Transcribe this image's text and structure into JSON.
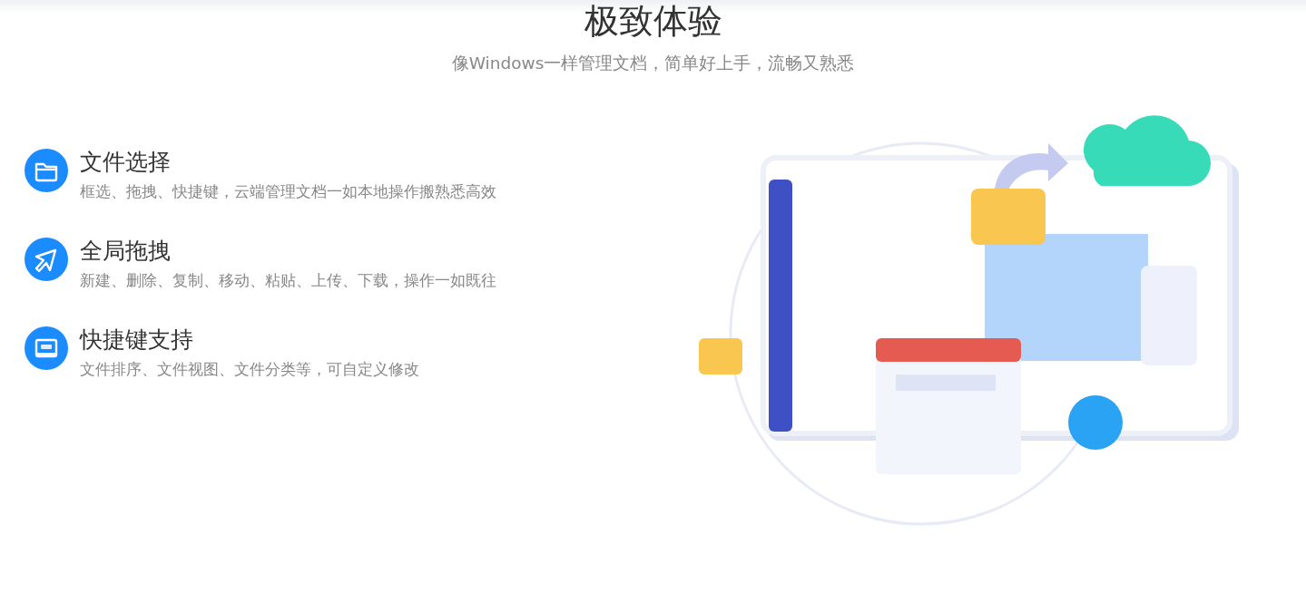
{
  "header": {
    "title": "极致体验",
    "subtitle": "像Windows一样管理文档，简单好上手，流畅又熟悉"
  },
  "features": [
    {
      "kind": "folder",
      "title": "文件选择",
      "description": "框选、拖拽、快捷键，云端管理文档一如本地操作搬熟悉高效"
    },
    {
      "kind": "cursor",
      "title": "全局拖拽",
      "description": "新建、删除、复制、移动、粘贴、上传、下载，操作一如既往"
    },
    {
      "kind": "keyboard",
      "title": "快捷键支持",
      "description": "文件排序、文件视图、文件分类等，可自定义修改"
    }
  ]
}
